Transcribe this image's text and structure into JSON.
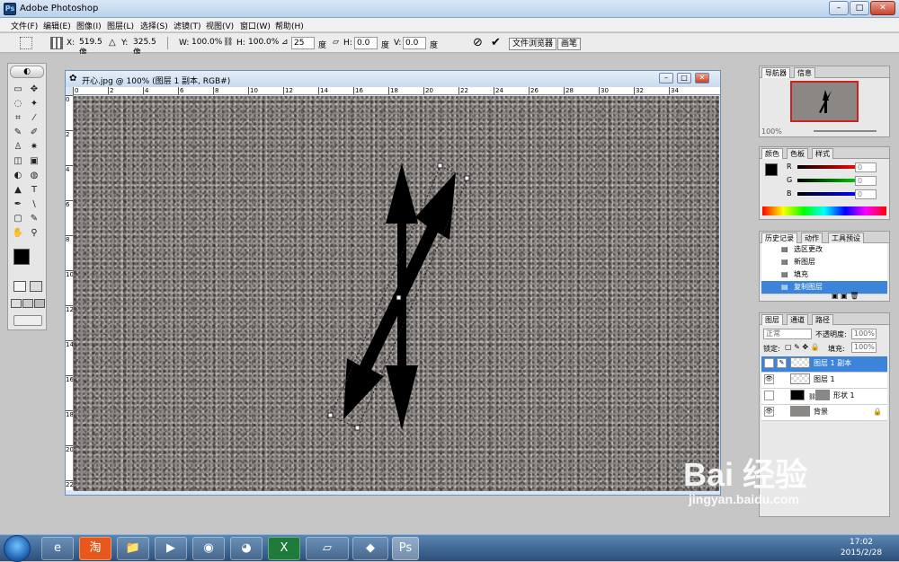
{
  "app": {
    "title": "Adobe Photoshop",
    "icon_label": "Ps",
    "window_buttons": {
      "minimize": "–",
      "maximize": "□",
      "close": "✕"
    }
  },
  "menu": {
    "items": [
      "文件(F)",
      "编辑(E)",
      "图像(I)",
      "图层(L)",
      "选择(S)",
      "滤镜(T)",
      "视图(V)",
      "窗口(W)",
      "帮助(H)"
    ]
  },
  "options_bar": {
    "x_label": "X:",
    "x_value": "519.5 像",
    "y_label": "Y:",
    "y_value": "325.5 像",
    "w_label": "W:",
    "w_value": "100.0%",
    "h_label": "H:",
    "h_value": "100.0%",
    "angle_value": "25",
    "angle_unit": "度",
    "hskew_label": "H:",
    "hskew_value": "0.0",
    "hskew_unit": "度",
    "vskew_label": "V:",
    "vskew_value": "0.0",
    "vskew_unit": "度",
    "cancel_icon": "⊘",
    "commit_icon": "✔",
    "well_tabs": [
      "文件浏览器",
      "画笔"
    ]
  },
  "toolbox": {
    "tools": [
      "▭",
      "✥",
      "◌",
      "✦",
      "⌗",
      "⁄",
      "✎",
      "✐",
      "♙",
      "✷",
      "◫",
      "▣",
      "◐",
      "◍",
      "▲",
      "T",
      "✒",
      "\\",
      "▢",
      "✎",
      "✋",
      "⚲",
      "■",
      "□",
      "◧",
      "▤",
      "◫",
      "▭"
    ]
  },
  "document": {
    "title": "开心.jpg @ 100% (图层 1 副本, RGB#)",
    "ruler_h_ticks": [
      "0",
      "2",
      "4",
      "6",
      "8",
      "10",
      "12",
      "14",
      "16",
      "18",
      "20",
      "22",
      "24",
      "26",
      "28",
      "30",
      "32",
      "34"
    ],
    "ruler_v_ticks": [
      "0",
      "2",
      "4",
      "6",
      "8",
      "10",
      "12",
      "14",
      "16",
      "18",
      "20",
      "22"
    ]
  },
  "navigator": {
    "tabs": [
      "导航器",
      "信息"
    ],
    "zoom": "100%"
  },
  "color_panel": {
    "tabs": [
      "颜色",
      "色板",
      "样式"
    ],
    "r_label": "R",
    "r_value": "0",
    "g_label": "G",
    "g_value": "0",
    "b_label": "B",
    "b_value": "0"
  },
  "history": {
    "tabs": [
      "历史记录",
      "动作",
      "工具预设"
    ],
    "items": [
      "选区更改",
      "新图层",
      "填充",
      "复制图层"
    ]
  },
  "layers": {
    "tabs": [
      "图层",
      "通道",
      "路径"
    ],
    "blend_mode": "正常",
    "opacity_label": "不透明度:",
    "opacity_value": "100%",
    "lock_label": "锁定:",
    "fill_label": "填充:",
    "fill_value": "100%",
    "items": [
      {
        "name": "图层 1 副本",
        "selected": true
      },
      {
        "name": "图层 1",
        "selected": false
      },
      {
        "name": "形状 1",
        "selected": false
      },
      {
        "name": "背景",
        "selected": false
      }
    ]
  },
  "taskbar": {
    "buttons": [
      "e",
      "淘",
      "📁",
      "▶",
      "◉",
      "◕",
      "X",
      "▱",
      "◆",
      "Ps"
    ],
    "time": "17:02",
    "date": "2015/2/28"
  },
  "watermark": {
    "brand": "Bai  经验",
    "url": "jingyan.baidu.com"
  }
}
